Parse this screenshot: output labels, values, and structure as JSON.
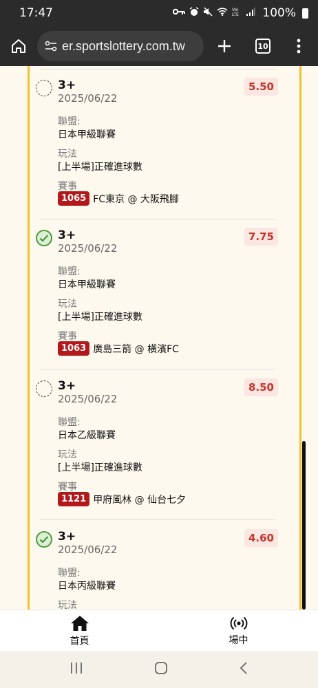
{
  "status_bar": {
    "time": "17:47",
    "battery": "100%"
  },
  "browser": {
    "url": "er.sportslottery.com.tw",
    "tab_count": "10"
  },
  "bets": [
    {
      "title": "3+",
      "date": "2025/06/22",
      "odds": "5.50",
      "checked": false,
      "league_label": "聯盟:",
      "league": "日本甲級聯賽",
      "play_label": "玩法",
      "play": "[上半場]正確進球數",
      "event_label": "賽事",
      "match_id": "1065",
      "match": "FC東京 @ 大阪飛腳"
    },
    {
      "title": "3+",
      "date": "2025/06/22",
      "odds": "7.75",
      "checked": true,
      "league_label": "聯盟:",
      "league": "日本甲級聯賽",
      "play_label": "玩法",
      "play": "[上半場]正確進球數",
      "event_label": "賽事",
      "match_id": "1063",
      "match": "廣島三箭 @ 橫濱FC"
    },
    {
      "title": "3+",
      "date": "2025/06/22",
      "odds": "8.50",
      "checked": false,
      "league_label": "聯盟:",
      "league": "日本乙級聯賽",
      "play_label": "玩法",
      "play": "[上半場]正確進球數",
      "event_label": "賽事",
      "match_id": "1121",
      "match": "甲府風林 @ 仙台七夕"
    },
    {
      "title": "3+",
      "date": "2025/06/22",
      "odds": "4.60",
      "checked": true,
      "league_label": "聯盟:",
      "league": "日本丙級聯賽",
      "play_label": "玩法"
    }
  ],
  "bottom_nav": {
    "home": "首頁",
    "live": "場中"
  }
}
